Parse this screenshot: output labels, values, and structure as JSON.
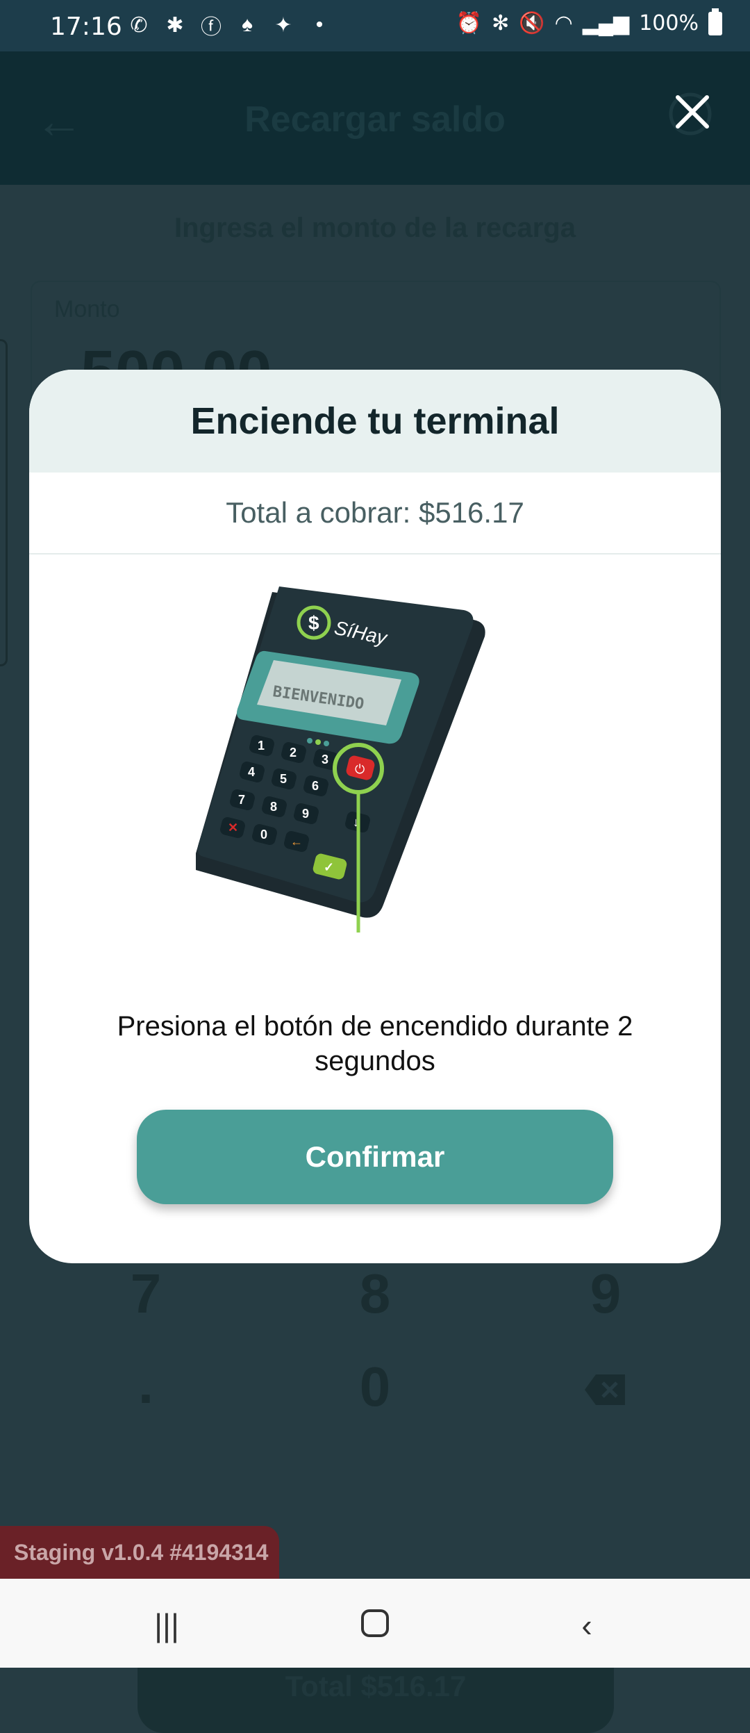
{
  "status_bar": {
    "time": "17:16",
    "battery": "100%",
    "notif_icons": [
      "whatsapp-icon",
      "slack-icon",
      "facebook-icon",
      "app-icon",
      "twitter-icon",
      "dot-icon"
    ],
    "right_icons": [
      "alarm-icon",
      "bluetooth-icon",
      "mute-icon",
      "wifi-icon",
      "signal-icon",
      "battery-icon"
    ]
  },
  "app_bar": {
    "title": "Recargar saldo"
  },
  "screen": {
    "subtitle": "Ingresa el monto de la recarga",
    "amount_label": "Monto",
    "amount_value": "500.00",
    "keys": [
      "7",
      "8",
      "9",
      ".",
      "0"
    ],
    "total_button": "Total $516.17",
    "staging_label": "Staging v1.0.4 #4194314"
  },
  "modal": {
    "title": "Enciende tu terminal",
    "total": "Total a cobrar: $516.17",
    "instruction": "Presiona el botón de encendido durante 2 segundos",
    "confirm_label": "Confirmar",
    "terminal": {
      "brand": "SíHay",
      "screen_text": "BIENVENIDO",
      "keypad": [
        "1",
        "2",
        "3",
        "4",
        "5",
        "6",
        "7",
        "8",
        "9",
        "0"
      ]
    }
  },
  "colors": {
    "accent": "#4a9e97",
    "header_bg": "#e8f1f0",
    "power_highlight": "#8fd14f",
    "power_button": "#d92a2a"
  }
}
